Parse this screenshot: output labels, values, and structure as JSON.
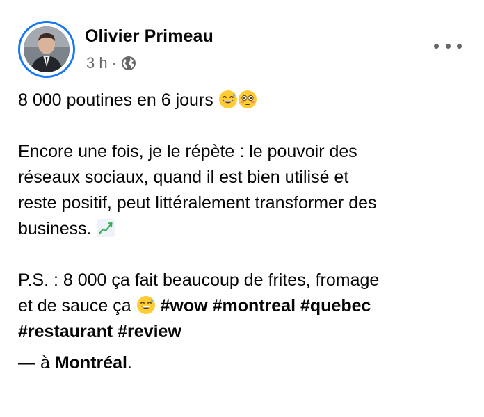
{
  "post": {
    "author": {
      "name": "Olivier Primeau"
    },
    "meta": {
      "time": "3 h",
      "separator": "·",
      "audience_icon": "globe-icon"
    },
    "more_icon": "more-horizontal-icon",
    "body": {
      "line1": "8 000 poutines en 6 jours",
      "line1_emojis": [
        "grinning-sweat-emoji",
        "flushed-face-emoji"
      ],
      "p2_line1": "Encore une fois, je le répète : le pouvoir des",
      "p2_line2": "réseaux sociaux, quand il est bien utilisé et",
      "p2_line3": "reste positif, peut littéralement transformer des",
      "p2_line4": "business.",
      "p2_emoji": "chart-increasing-emoji",
      "p3_line1": "P.S. : 8 000 ça fait beaucoup de frites, fromage",
      "p3_line2": "et de sauce ça",
      "p3_emoji": "grinning-sweat-emoji",
      "hashtags_line2": [
        "#wow",
        "#montreal",
        "#quebec"
      ],
      "hashtags_line3": [
        "#restaurant",
        "#review"
      ]
    },
    "location": {
      "prefix": "— à",
      "place": "Montréal",
      "suffix": "."
    }
  },
  "colors": {
    "ring": "#1877f2",
    "text": "#050505",
    "secondary": "#65676b"
  }
}
